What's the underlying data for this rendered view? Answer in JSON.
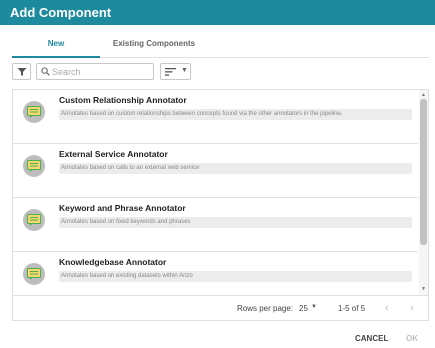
{
  "dialog": {
    "title": "Add Component"
  },
  "tabs": [
    {
      "label": "New",
      "active": true
    },
    {
      "label": "Existing Components",
      "active": false
    }
  ],
  "toolbar": {
    "filter_icon": "filter-icon",
    "search_placeholder": "Search",
    "search_value": "",
    "sort_icon": "sort-icon"
  },
  "items": [
    {
      "name": "Custom Relationship Annotator",
      "description": "Annotates based on custom relationships between concepts found via the other annotators in the pipeline."
    },
    {
      "name": "External Service Annotator",
      "description": "Annotates based on calls to an external web service"
    },
    {
      "name": "Keyword and Phrase Annotator",
      "description": "Annotates based on fixed keywords and phrases"
    },
    {
      "name": "Knowledgebase Annotator",
      "description": "Annotates based on existing datasets within Anzo"
    }
  ],
  "pagination": {
    "rows_per_page_label": "Rows per page:",
    "rows_per_page_value": "25",
    "range": "1-5 of 5"
  },
  "footer": {
    "cancel_label": "CANCEL",
    "ok_label": "OK"
  },
  "colors": {
    "accent": "#1d8a9e",
    "avatar_bg": "#bdbdbd",
    "icon_yellow": "#f5d76e",
    "icon_green": "#4caf50"
  }
}
